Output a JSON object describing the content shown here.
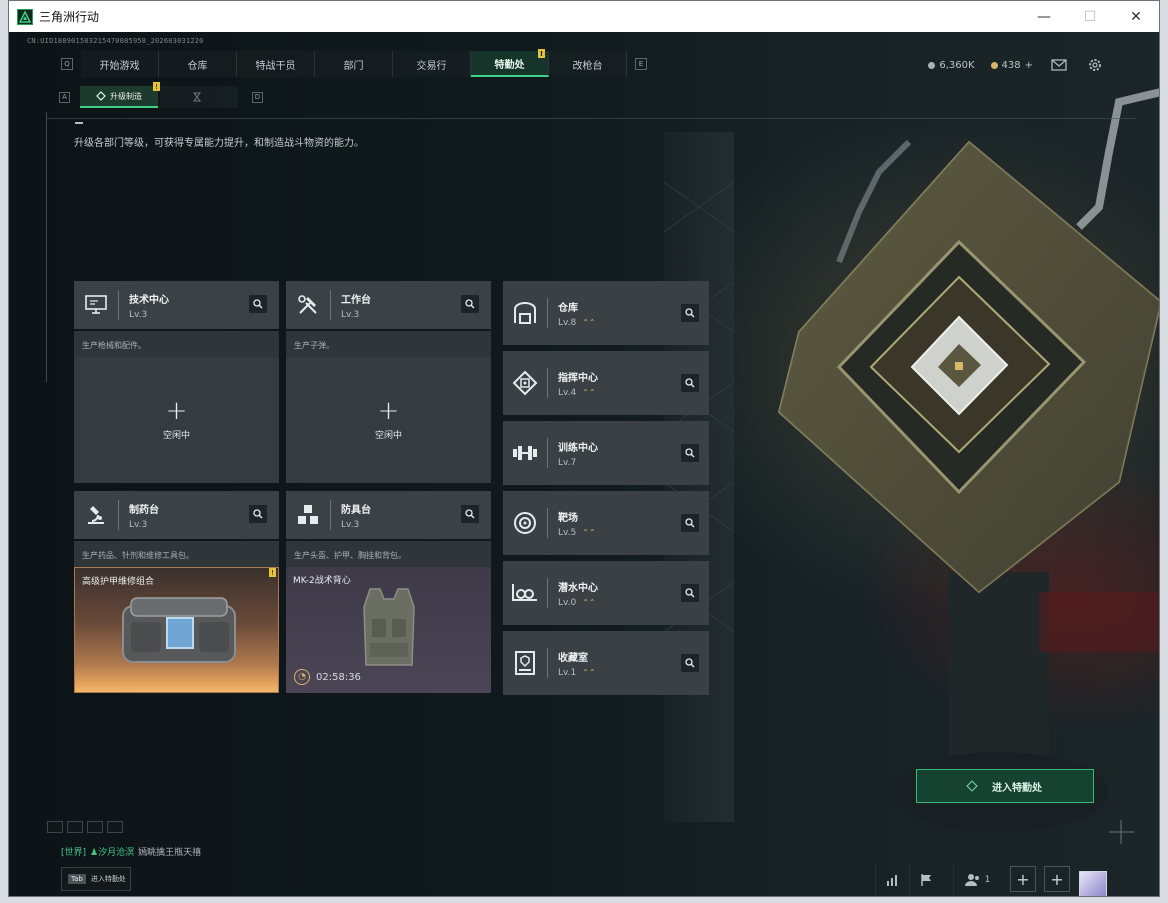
{
  "window": {
    "title": "三角洲行动",
    "controls": {
      "minimize": "—",
      "maximize": "☐",
      "close": "✕"
    }
  },
  "session_id": "CN:UID188901503215470085958_202603031220",
  "nav": {
    "left_key": "Q",
    "right_key": "E",
    "tabs": [
      {
        "label": "开始游戏",
        "active": false
      },
      {
        "label": "仓库",
        "active": false
      },
      {
        "label": "特战干员",
        "active": false
      },
      {
        "label": "部门",
        "active": false
      },
      {
        "label": "交易行",
        "active": false
      },
      {
        "label": "特勤处",
        "active": true,
        "alert": "!"
      },
      {
        "label": "改枪台",
        "active": false
      }
    ]
  },
  "currency": {
    "silver": "6,360K",
    "gold": "438",
    "gold_add": "+"
  },
  "subnav": {
    "left_key": "A",
    "right_key": "D",
    "tabs": [
      {
        "label": "升级制造",
        "active": true,
        "alert": "!"
      },
      {
        "label": "",
        "active": false
      }
    ]
  },
  "description": "升级各部门等级，可获得专属能力提升，和制造战斗物资的能力。",
  "workshops": [
    {
      "name": "技术中心",
      "level": "Lv.3",
      "subtitle": "生产枪械和配件。",
      "status": "空闲中",
      "plus": "+",
      "icon": "monitor-icon"
    },
    {
      "name": "工作台",
      "level": "Lv.3",
      "subtitle": "生产子弹。",
      "status": "空闲中",
      "plus": "+",
      "icon": "tools-icon"
    },
    {
      "name": "制药台",
      "level": "Lv.3",
      "subtitle": "生产药品、针剂和维修工具包。",
      "item": "高级护甲维修组合",
      "alert": "!",
      "icon": "microscope-icon"
    },
    {
      "name": "防具台",
      "level": "Lv.3",
      "subtitle": "生产头盔、护甲、胸挂和背包。",
      "item": "MK-2战术背心",
      "timer": "02:58:36",
      "icon": "armor-parts-icon"
    }
  ],
  "facilities": [
    {
      "name": "仓库",
      "level": "Lv.8",
      "upgradable": true,
      "icon": "warehouse-icon"
    },
    {
      "name": "指挥中心",
      "level": "Lv.4",
      "upgradable": true,
      "icon": "command-icon"
    },
    {
      "name": "训练中心",
      "level": "Lv.7",
      "upgradable": false,
      "icon": "dumbbell-icon"
    },
    {
      "name": "靶场",
      "level": "Lv.5",
      "upgradable": true,
      "icon": "target-icon"
    },
    {
      "name": "潜水中心",
      "level": "Lv.0",
      "upgradable": true,
      "icon": "diving-icon"
    },
    {
      "name": "收藏室",
      "level": "Lv.1",
      "upgradable": true,
      "icon": "collection-icon"
    }
  ],
  "upgrade_glyph": "⌃⌃",
  "enter_button": "进入特勤处",
  "chat": {
    "channel": "[世界]",
    "user": "♟汐月沧溟",
    "message": "嫣眺擒王瓶天禧"
  },
  "tab_hint": {
    "key": "Tab",
    "label": "进入特勤处"
  },
  "bottom_bar": {
    "team_count": "1",
    "add1": "+",
    "add2": "+"
  },
  "colors": {
    "accent_green": "#3fd08a",
    "alert_yellow": "#e7c23b",
    "upgrade_gold": "#d9b85c",
    "card_bg": "#3a4043"
  }
}
